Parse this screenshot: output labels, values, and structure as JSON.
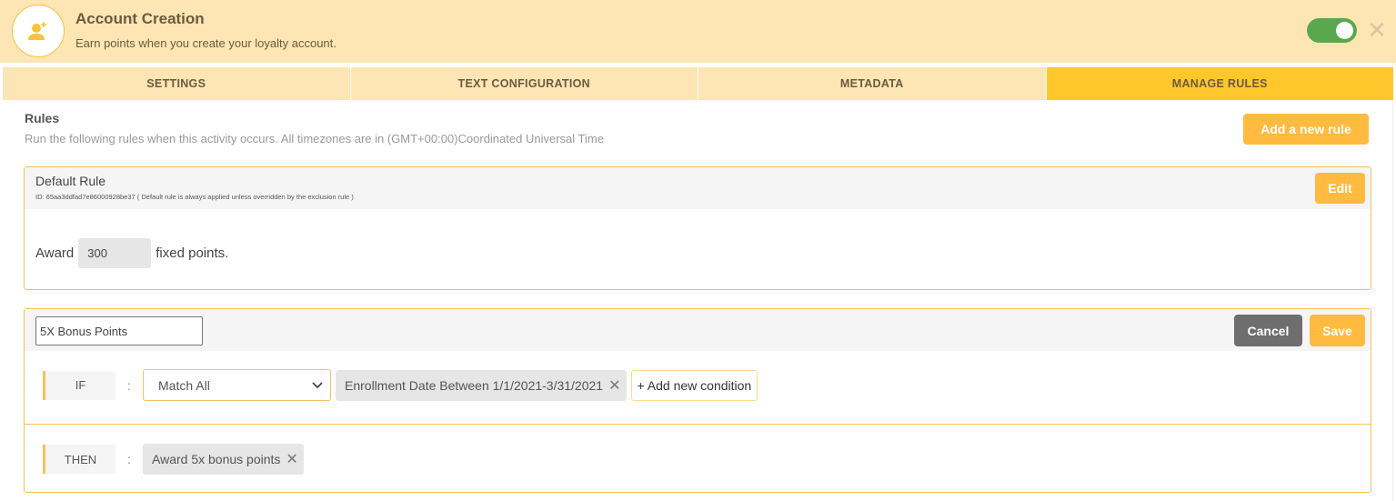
{
  "header": {
    "title": "Account Creation",
    "subtitle": "Earn points when you create your loyalty account.",
    "icon": "user-plus-icon",
    "toggle_on": true,
    "close_icon": "✕"
  },
  "tabs": [
    {
      "label": "SETTINGS",
      "active": false
    },
    {
      "label": "TEXT CONFIGURATION",
      "active": false
    },
    {
      "label": "METADATA",
      "active": false
    },
    {
      "label": "MANAGE RULES",
      "active": true
    }
  ],
  "rules": {
    "title": "Rules",
    "description": "Run the following rules when this activity occurs. All timezones are in (GMT+00:00)Coordinated Universal Time",
    "add_button": "Add a new rule"
  },
  "default_rule": {
    "name": "Default Rule",
    "id_text": "ID: 65aa3ddfad7e86000928be37 ( Default rule is always applied unless overridden by the exclusion rule )",
    "edit_button": "Edit",
    "award_prefix": "Award",
    "points_value": "300",
    "award_suffix": "fixed points."
  },
  "bonus_rule": {
    "name_value": "5X Bonus Points",
    "cancel_button": "Cancel",
    "save_button": "Save",
    "if_label": "IF",
    "colon": ":",
    "match_select": "Match All",
    "conditions": [
      "Enrollment Date Between 1/1/2021-3/31/2021"
    ],
    "add_condition": "+ Add new condition",
    "then_label": "THEN",
    "actions": [
      "Award 5x bonus points"
    ],
    "remove_glyph": "✕"
  },
  "colors": {
    "header_bg": "#fde5b4",
    "active_tab": "#ffc72c",
    "button_yellow": "#ffbb3f",
    "button_gray": "#6e6e6e",
    "toggle_green": "#5aa84d",
    "card_border": "#f5c15a"
  }
}
